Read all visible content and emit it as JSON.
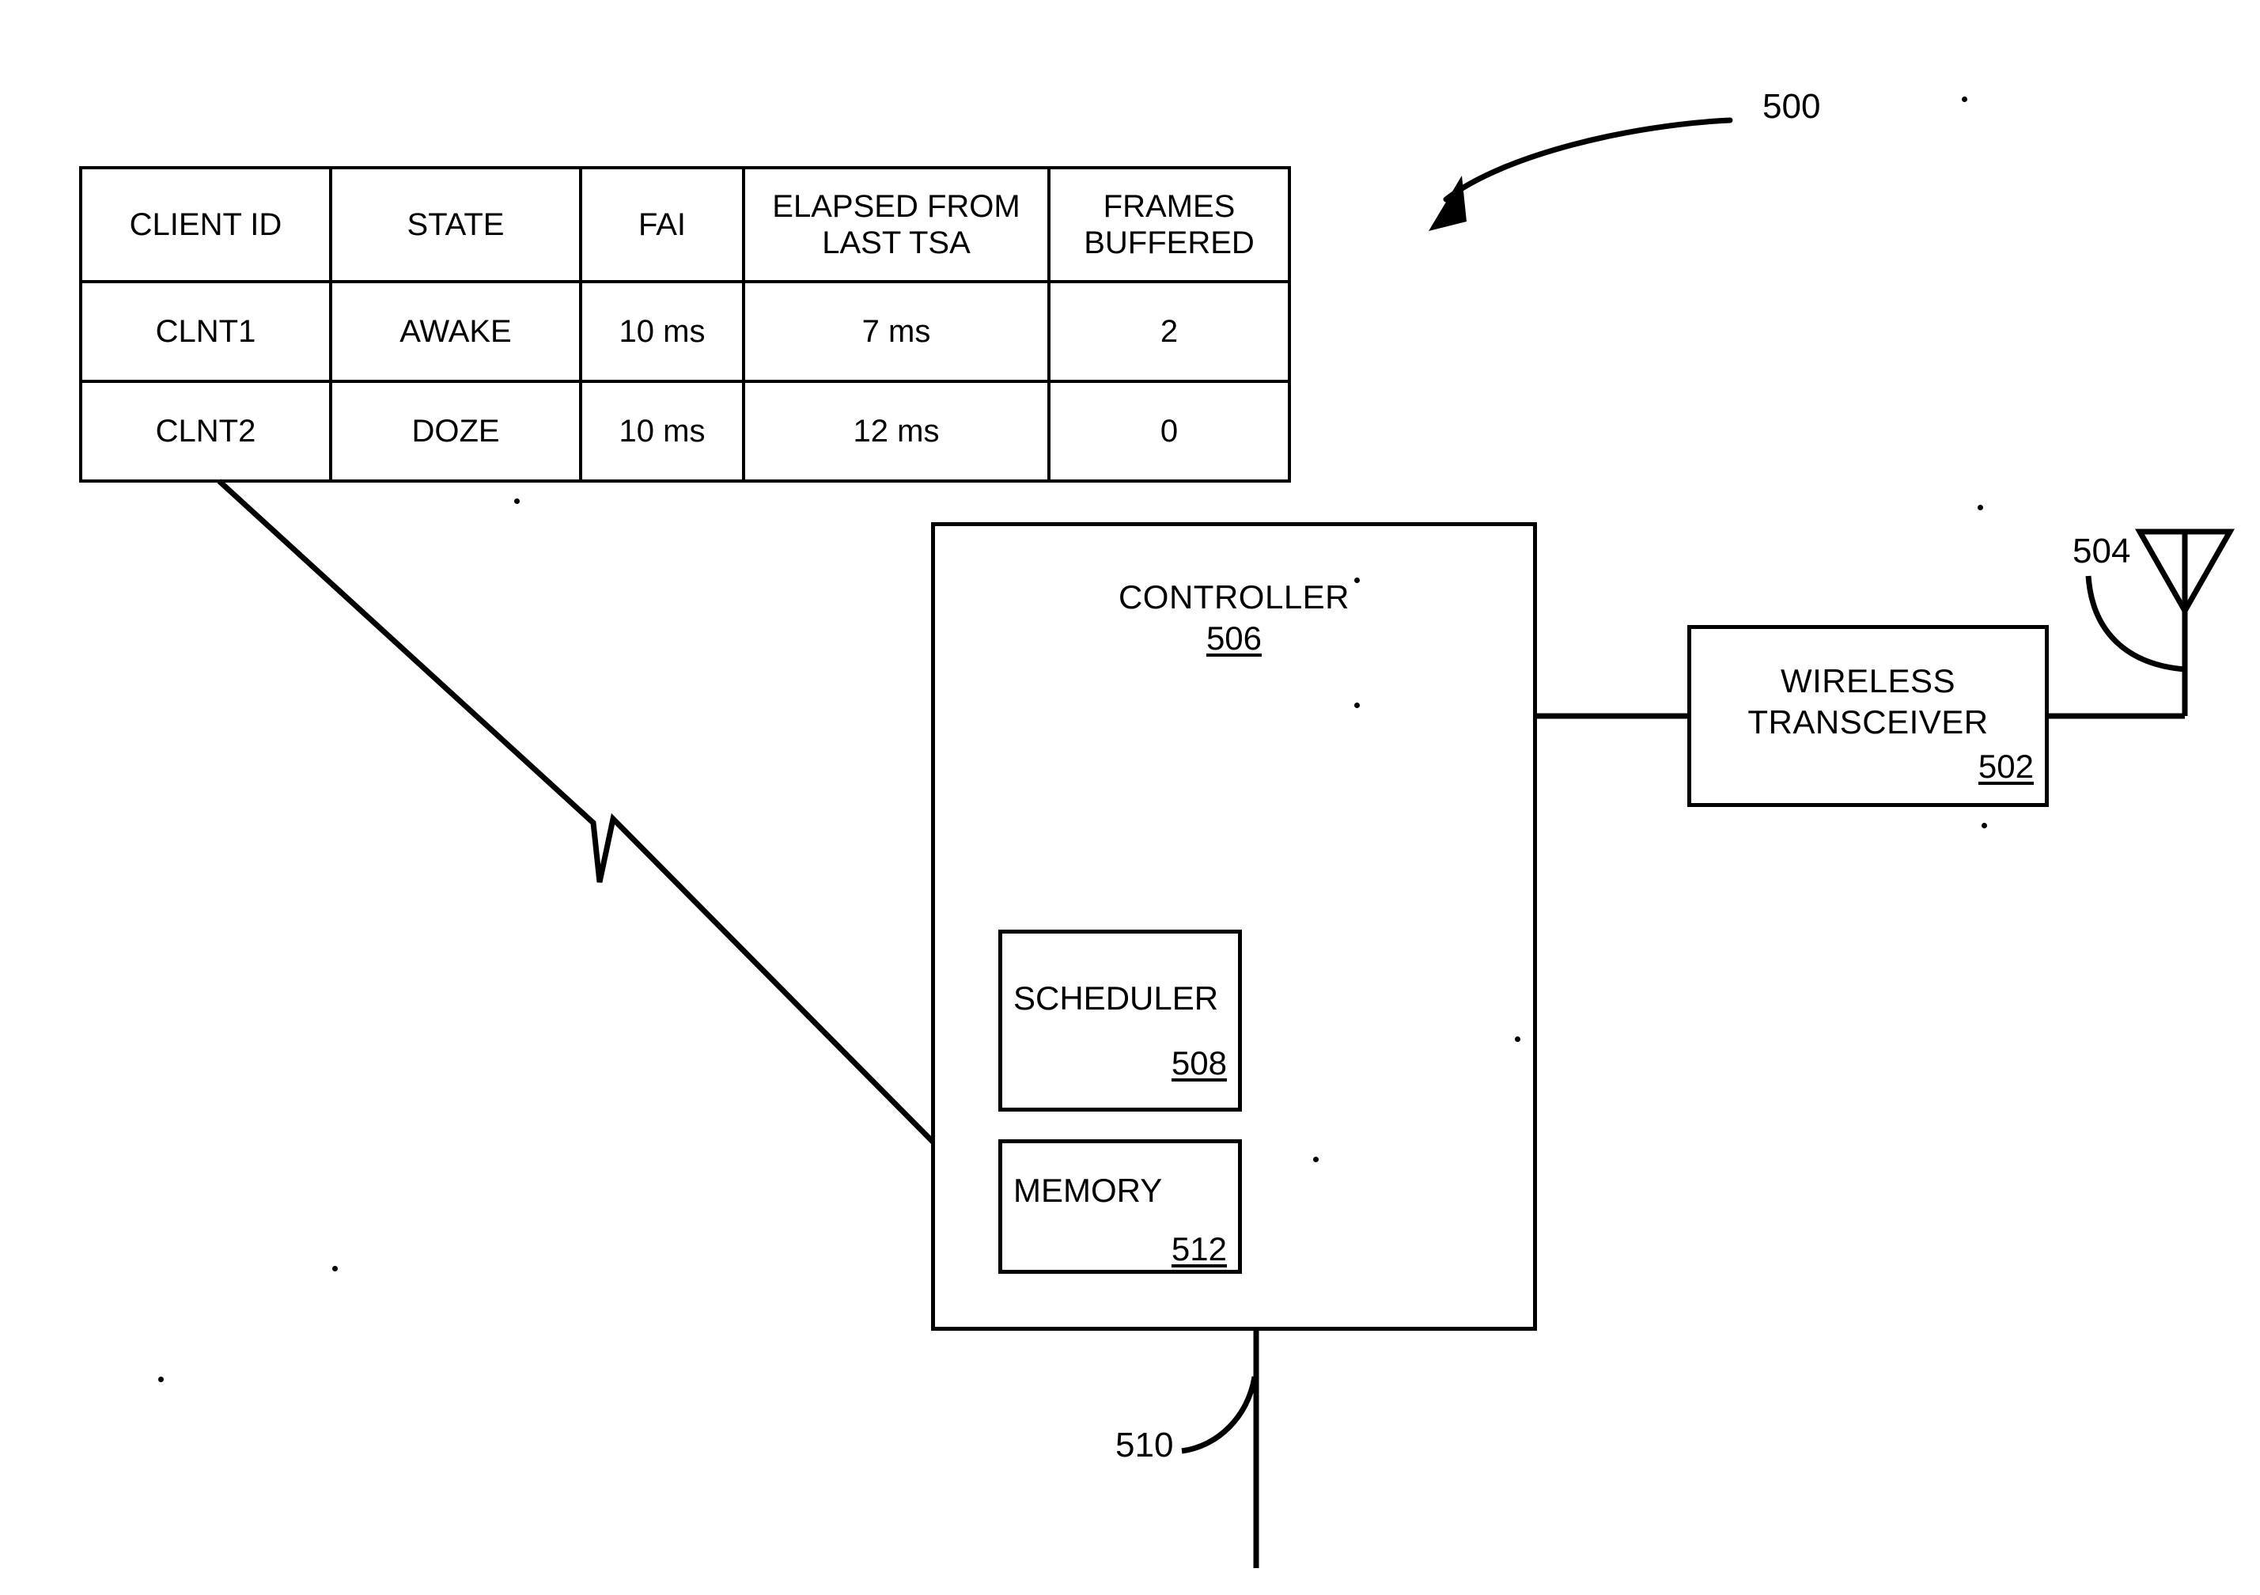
{
  "figure": {
    "number": "500",
    "type": "block-diagram"
  },
  "table": {
    "name": "client-state-table",
    "headers": [
      "CLIENT ID",
      "STATE",
      "FAI",
      "ELAPSED FROM\nLAST TSA",
      "FRAMES\nBUFFERED"
    ],
    "rows": [
      [
        "CLNT1",
        "AWAKE",
        "10 ms",
        "7 ms",
        "2"
      ],
      [
        "CLNT2",
        "DOZE",
        "10 ms",
        "12 ms",
        "0"
      ]
    ]
  },
  "blocks": {
    "controller": {
      "title": "CONTROLLER",
      "ref": "506"
    },
    "scheduler": {
      "title": "SCHEDULER",
      "ref": "508"
    },
    "memory": {
      "title": "MEMORY",
      "ref": "512"
    },
    "transceiver": {
      "title_line1": "WIRELESS",
      "title_line2": "TRANSCEIVER",
      "ref": "502"
    }
  },
  "callouts": {
    "figure_ref": "500",
    "antenna_ref": "504",
    "bus_ref": "510"
  },
  "colors": {
    "ink": "#000000",
    "paper": "#ffffff"
  }
}
